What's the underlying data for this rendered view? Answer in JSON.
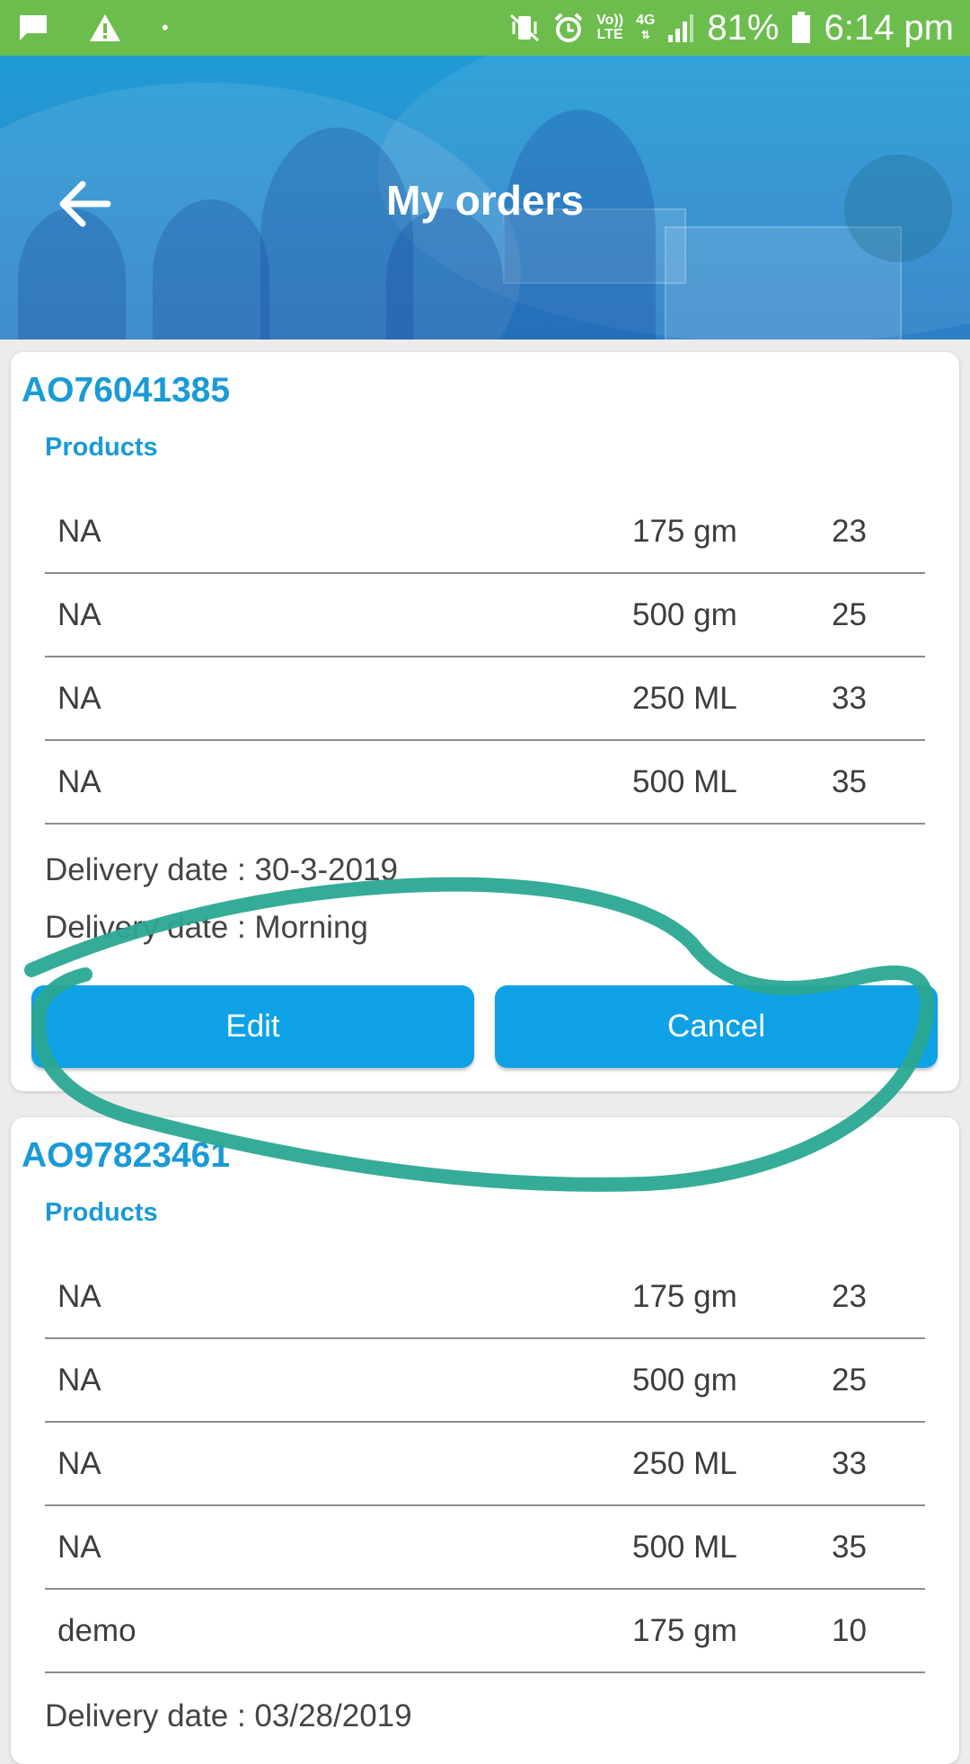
{
  "status_bar": {
    "volte_top": "Vo))",
    "volte_bottom": "LTE",
    "network": "4G",
    "battery": "81%",
    "time": "6:14 pm"
  },
  "header": {
    "title": "My orders",
    "back_icon": "arrow-left-icon"
  },
  "orders": [
    {
      "id": "AO76041385",
      "products_label": "Products",
      "items": [
        {
          "name": "NA",
          "size": "175 gm",
          "qty": "23"
        },
        {
          "name": "NA",
          "size": "500 gm",
          "qty": "25"
        },
        {
          "name": "NA",
          "size": "250 ML",
          "qty": "33"
        },
        {
          "name": "NA",
          "size": "500 ML",
          "qty": "35"
        }
      ],
      "delivery_date": "Delivery date : 30-3-2019",
      "delivery_time": "Delivery date : Morning",
      "edit_label": "Edit",
      "cancel_label": "Cancel"
    },
    {
      "id": "AO97823461",
      "products_label": "Products",
      "items": [
        {
          "name": "NA",
          "size": "175 gm",
          "qty": "23"
        },
        {
          "name": "NA",
          "size": "500 gm",
          "qty": "25"
        },
        {
          "name": "NA",
          "size": "250 ML",
          "qty": "33"
        },
        {
          "name": "NA",
          "size": "500 ML",
          "qty": "35"
        },
        {
          "name": "demo",
          "size": "175 gm",
          "qty": "10"
        }
      ],
      "delivery_date": "Delivery date : 03/28/2019"
    }
  ],
  "colors": {
    "status_bar": "#6cbd4d",
    "header": "#1f9bd5",
    "accent": "#1a9ad6",
    "button": "#0ea1e6",
    "annotation": "#2aa892"
  }
}
